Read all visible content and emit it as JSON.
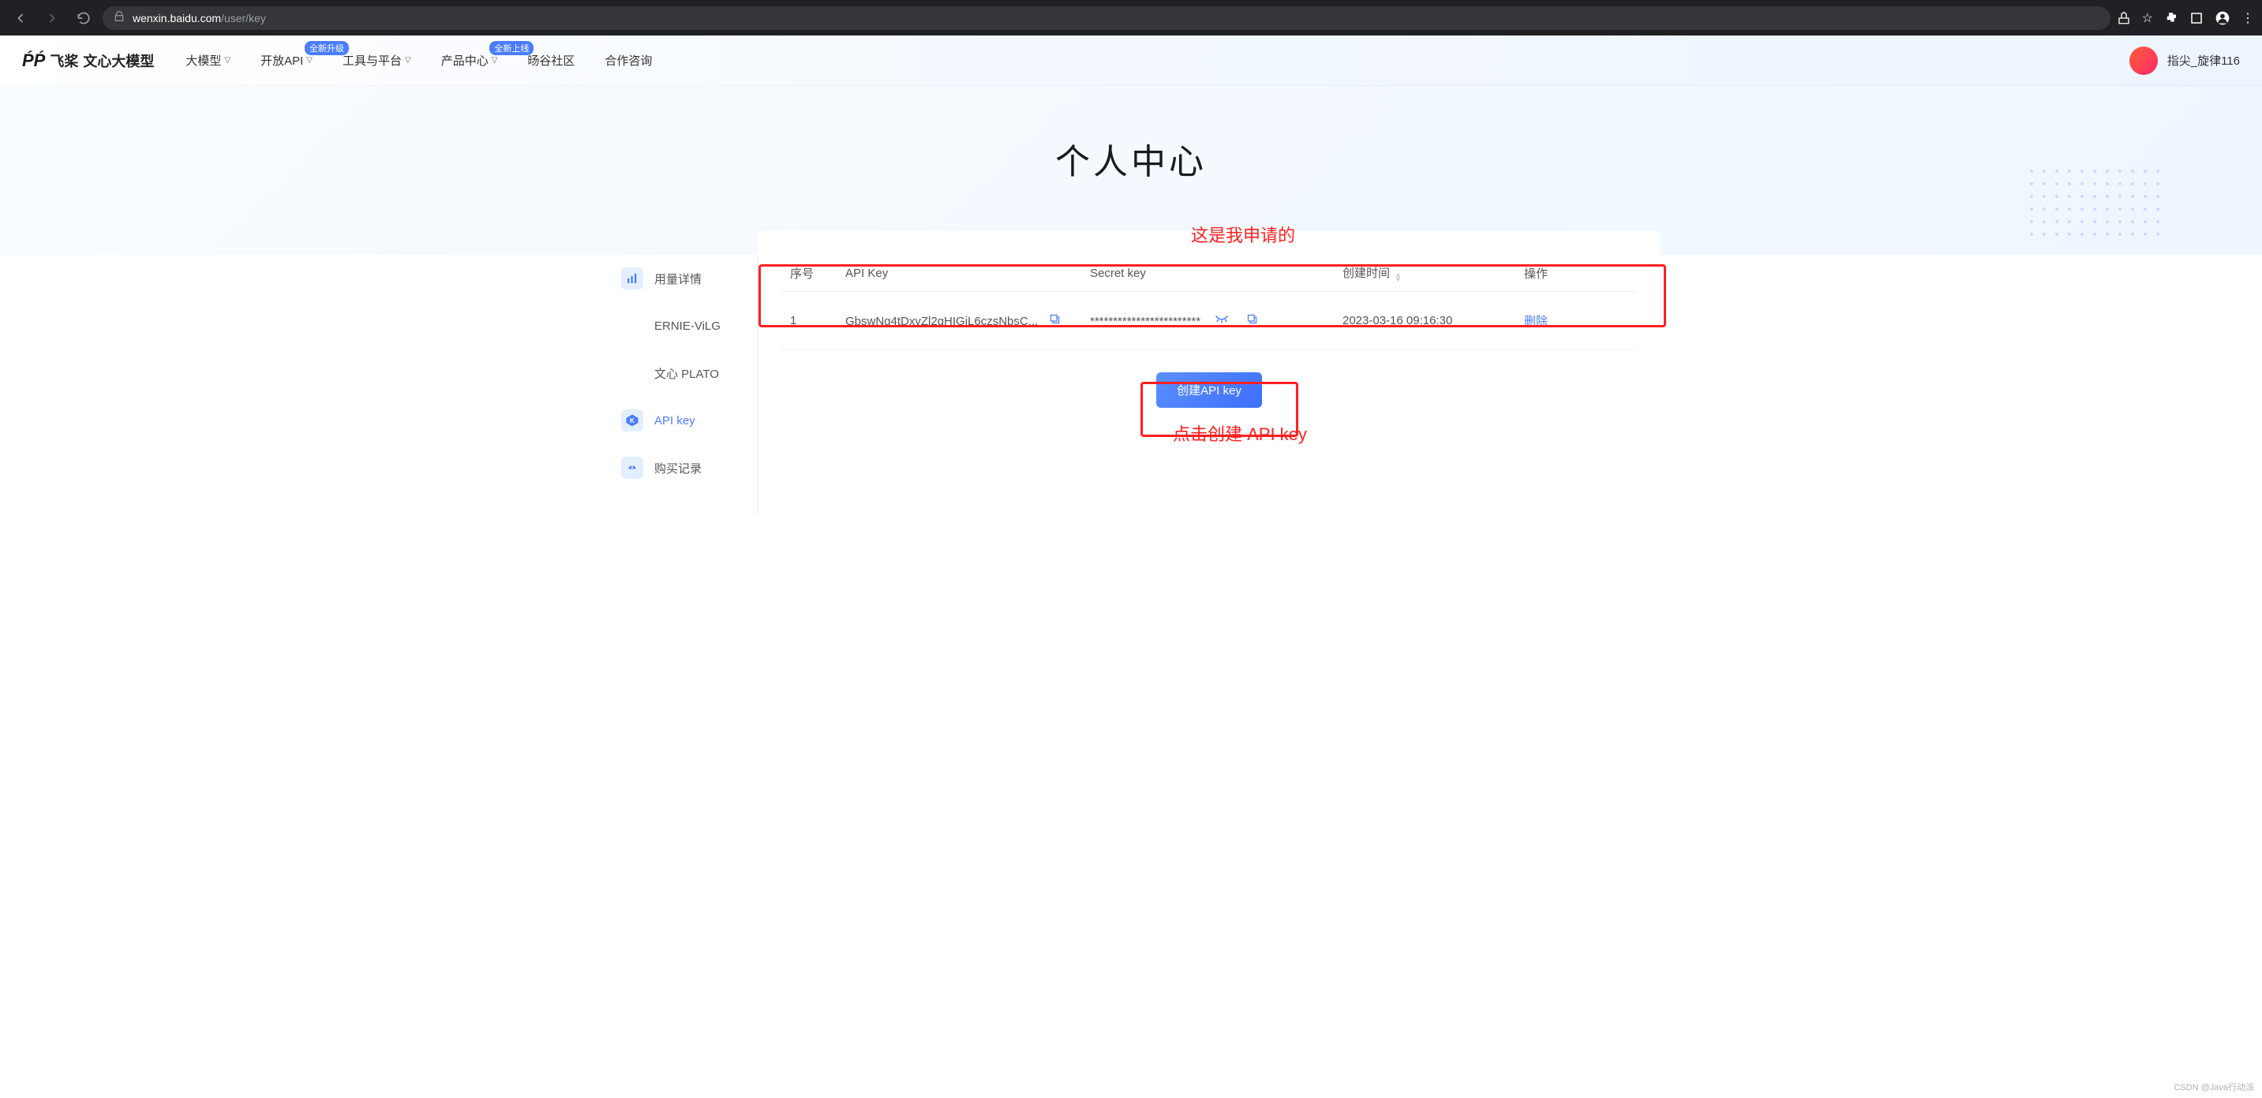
{
  "browser": {
    "url_domain": "wenxin.baidu.com",
    "url_path": "/user/key"
  },
  "topnav": {
    "logo_text1": "飞桨",
    "logo_text2": "文心大模型",
    "items": [
      {
        "label": "大模型",
        "caret": true,
        "badge": null
      },
      {
        "label": "开放API",
        "caret": true,
        "badge": "全新升级"
      },
      {
        "label": "工具与平台",
        "caret": true,
        "badge": null
      },
      {
        "label": "产品中心",
        "caret": true,
        "badge": "全新上线"
      },
      {
        "label": "旸谷社区",
        "caret": false,
        "badge": null
      },
      {
        "label": "合作咨询",
        "caret": false,
        "badge": null
      }
    ],
    "username": "指尖_旋律116"
  },
  "hero": {
    "title": "个人中心"
  },
  "sidebar": {
    "items": [
      {
        "label": "用量详情"
      },
      {
        "label": "ERNIE-ViLG"
      },
      {
        "label": "文心 PLATO"
      },
      {
        "label": "API key"
      },
      {
        "label": "购买记录"
      }
    ]
  },
  "table": {
    "headers": {
      "seq": "序号",
      "api_key": "API Key",
      "secret_key": "Secret key",
      "created": "创建时间",
      "action": "操作"
    },
    "rows": [
      {
        "seq": "1",
        "api_key": "GbswNg4tDxvZl2gHIGjL6czsNbsC...",
        "secret_key": "************************",
        "created": "2023-03-16 09:16:30",
        "action": "删除"
      }
    ]
  },
  "buttons": {
    "create": "创建API key"
  },
  "annotations": {
    "top": "这是我申请的",
    "bottom": "点击创建 API key"
  },
  "watermark": "CSDN @Java行动派"
}
